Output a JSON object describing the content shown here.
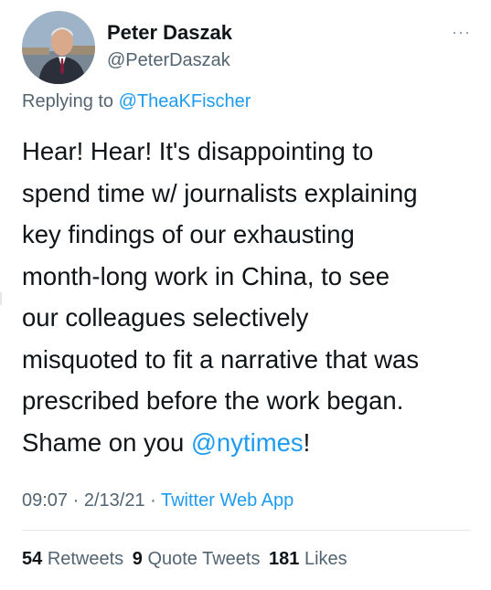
{
  "author": {
    "name": "Peter Daszak",
    "handle": "@PeterDaszak"
  },
  "replying_to": {
    "prefix": "Replying to",
    "handle": "@TheaKFischer"
  },
  "tweet": {
    "text_main": "Hear! Hear! It's disappointing to\nspend time w/ journalists explaining\nkey findings of our exhausting\nmonth-long work in China, to see\nour colleagues selectively\nmisquoted to fit a narrative that was\nprescribed before the work began.\nShame on you ",
    "mention": "@nytimes",
    "text_end": "!"
  },
  "meta": {
    "time": "09:07",
    "date": "2/13/21",
    "separator": " · ",
    "source": "Twitter Web App"
  },
  "stats": {
    "retweets_count": "54",
    "retweets_label": "Retweets",
    "quotes_count": "9",
    "quotes_label": "Quote Tweets",
    "likes_count": "181",
    "likes_label": "Likes"
  },
  "icons": {
    "more": "more-options-icon"
  },
  "colors": {
    "link": "#1d9bf0",
    "secondary": "#536471",
    "text": "#0f1419"
  }
}
